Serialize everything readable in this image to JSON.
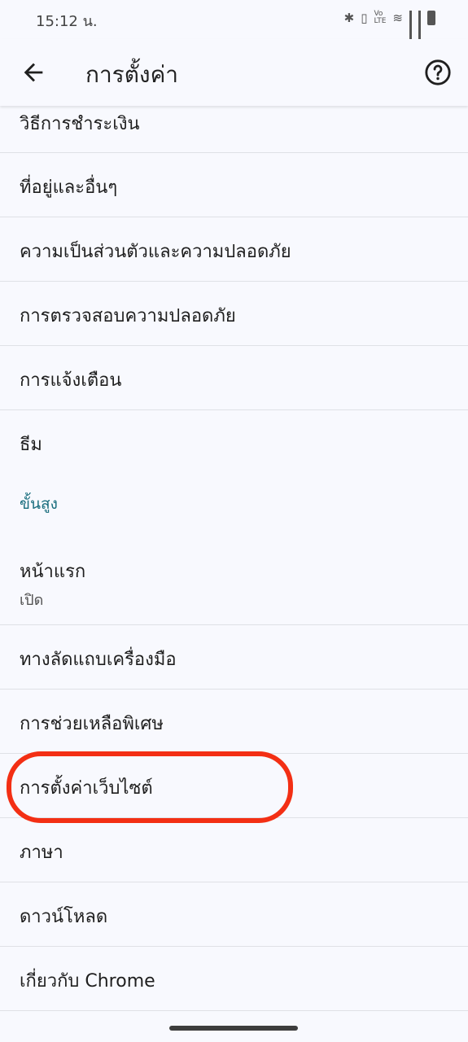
{
  "status_bar": {
    "time": "15:12 น.",
    "icons": [
      "bluetooth-icon",
      "vibrate-icon",
      "volte-icon",
      "wifi-icon",
      "signal-icon",
      "signal-icon",
      "battery-icon"
    ]
  },
  "app_bar": {
    "title": "การตั้งค่า",
    "back_icon": "arrow-back-icon",
    "help_icon": "help-circle-icon"
  },
  "settings": {
    "payment_methods": "วิธีการชำระเงิน",
    "addresses": "ที่อยู่และอื่นๆ",
    "privacy_security": "ความเป็นส่วนตัวและความปลอดภัย",
    "safety_check": "การตรวจสอบความปลอดภัย",
    "notifications": "การแจ้งเตือน",
    "theme": "ธีม",
    "advanced_header": "ขั้นสูง",
    "homepage": "หน้าแรก",
    "homepage_status": "เปิด",
    "toolbar_shortcut": "ทางลัดแถบเครื่องมือ",
    "accessibility": "การช่วยเหลือพิเศษ",
    "site_settings": "การตั้งค่าเว็บไซต์",
    "languages": "ภาษา",
    "downloads": "ดาวน์โหลด",
    "about_chrome": "เกี่ยวกับ Chrome"
  },
  "colors": {
    "background": "#f8f9fe",
    "section_header": "#1a6e7e",
    "highlight": "#f32f14"
  }
}
